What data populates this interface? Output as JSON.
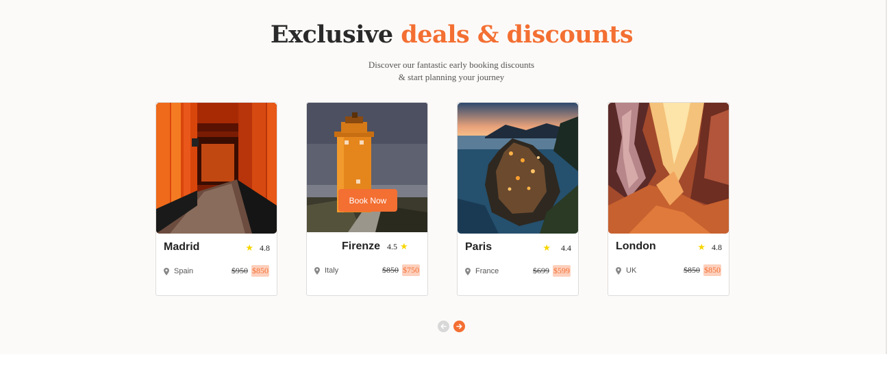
{
  "header": {
    "title_main": "Exclusive",
    "title_accent": "deals & discounts",
    "subtitle_line1": "Discover our fantastic early booking discounts",
    "subtitle_line2": "& start planning your journey"
  },
  "colors": {
    "accent": "#f36f32",
    "star": "#f7d600",
    "price_highlight_bg": "#fdd0bd",
    "section_bg": "#fcfaf8"
  },
  "deals": [
    {
      "city": "Madrid",
      "rating": "4.8",
      "country": "Spain",
      "old_price": "$950",
      "new_price": "$850"
    },
    {
      "city": "Firenze",
      "rating": "4.5",
      "country": "Italy",
      "old_price": "$850",
      "new_price": "$750",
      "button": "Book Now"
    },
    {
      "city": "Paris",
      "rating": "4.4",
      "country": "France",
      "old_price": "$699",
      "new_price": "$599"
    },
    {
      "city": "London",
      "rating": "4.8",
      "country": "UK",
      "old_price": "$850",
      "new_price": "$850"
    }
  ],
  "icons": {
    "star": "★",
    "location": "map-pin-icon",
    "prev": "arrow-left-icon",
    "next": "arrow-right-icon"
  }
}
